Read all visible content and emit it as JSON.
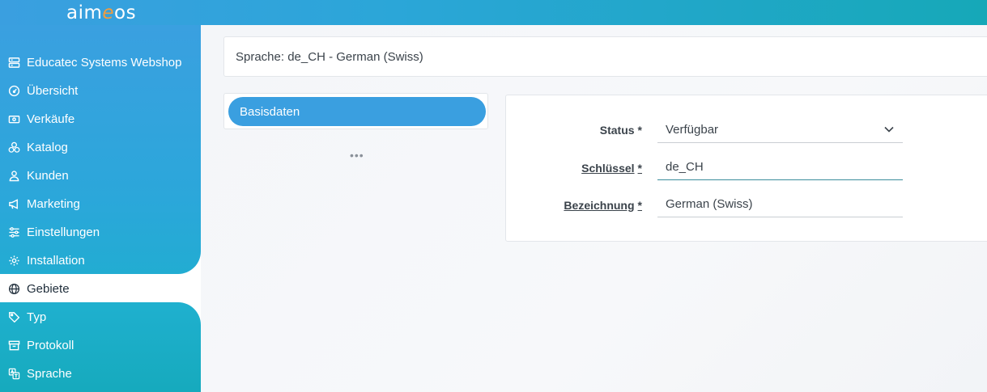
{
  "brand": {
    "logo_left": "aim",
    "logo_e": "e",
    "logo_right": "os"
  },
  "sidebar": {
    "items": [
      {
        "label": "Educatec Systems Webshop",
        "icon": "server-icon"
      },
      {
        "label": "Übersicht",
        "icon": "dashboard-icon"
      },
      {
        "label": "Verkäufe",
        "icon": "cash-icon"
      },
      {
        "label": "Katalog",
        "icon": "boxes-icon"
      },
      {
        "label": "Kunden",
        "icon": "user-icon"
      },
      {
        "label": "Marketing",
        "icon": "megaphone-icon"
      },
      {
        "label": "Einstellungen",
        "icon": "sliders-icon"
      },
      {
        "label": "Installation",
        "icon": "gear-icon"
      },
      {
        "label": "Gebiete",
        "icon": "globe-icon",
        "active": true
      },
      {
        "label": "Typ",
        "icon": "tag-icon"
      },
      {
        "label": "Protokoll",
        "icon": "archive-icon"
      },
      {
        "label": "Sprache",
        "icon": "translate-icon"
      }
    ]
  },
  "main": {
    "language_title": "Sprache: de_CH - German (Swiss)",
    "tabs": [
      {
        "label": "Basisdaten"
      }
    ],
    "more": "•••",
    "form": {
      "status": {
        "label": "Status",
        "required": "*",
        "value": "Verfügbar"
      },
      "key": {
        "label": "Schlüssel",
        "required": "*",
        "value": "de_CH"
      },
      "name": {
        "label": "Bezeichnung",
        "required": "*",
        "value": "German (Swiss)"
      }
    }
  },
  "colors": {
    "accent": "#3a9fe0",
    "teal": "#16aabd"
  }
}
